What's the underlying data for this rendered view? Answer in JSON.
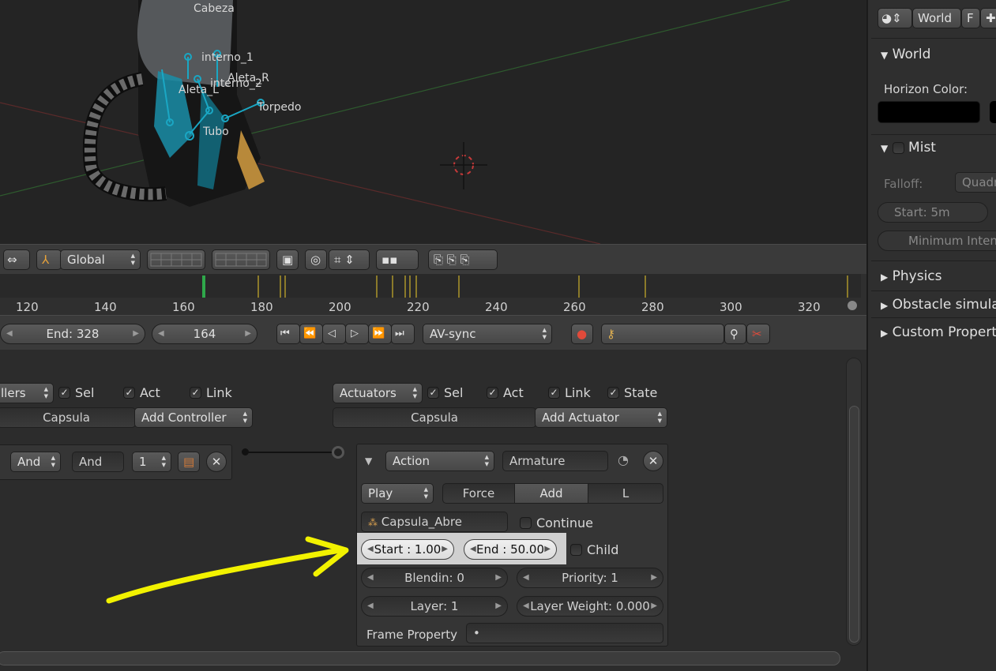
{
  "viewport": {
    "bones": [
      "Cabeza",
      "interno_1",
      "Aleta_R",
      "interno_2",
      "Aleta_L",
      "Torpedo",
      "Tubo"
    ]
  },
  "view_header": {
    "orientation": "Global"
  },
  "timeline": {
    "ticks": [
      "120",
      "140",
      "160",
      "180",
      "200",
      "220",
      "240",
      "260",
      "280",
      "300",
      "320"
    ],
    "end_label": "End: 328",
    "current_frame": "164",
    "sync": "AV-sync"
  },
  "controllers": {
    "menu": "llers",
    "sel": "Sel",
    "act": "Act",
    "link": "Link",
    "object_name": "Capsula",
    "add_button": "Add Controller",
    "and_type": "And",
    "and_name": "And",
    "state": "1"
  },
  "actuators": {
    "menu": "Actuators",
    "sel": "Sel",
    "act": "Act",
    "link": "Link",
    "state": "State",
    "object_name": "Capsula",
    "add_button": "Add Actuator",
    "actuator": {
      "type": "Action",
      "name": "Armature",
      "play_mode": "Play",
      "force": "Force",
      "add": "Add",
      "local": "L",
      "action_name": "Capsula_Abre",
      "continue": "Continue",
      "start": "Start : 1.00",
      "end": "End : 50.00",
      "child": "Child",
      "blendin": "Blendin: 0",
      "priority": "Priority: 1",
      "layer": "Layer: 1",
      "layer_weight": "Layer Weight: 0.000",
      "frame_property_label": "Frame Property",
      "frame_property_value": "•"
    }
  },
  "properties": {
    "world_name": "World",
    "world_f": "F",
    "world_section": "World",
    "horizon_color": "Horizon Color:",
    "mist": "Mist",
    "falloff": "Falloff:",
    "falloff_value": "Quadr",
    "mist_start": "Start: 5m",
    "min_intensity": "Minimum Inten",
    "physics": "Physics",
    "obstacle": "Obstacle simula",
    "custom_props": "Custom Propert"
  },
  "colors": {
    "annotation_arrow": "#f2f200",
    "armature_blue": "#1aa7c4"
  }
}
